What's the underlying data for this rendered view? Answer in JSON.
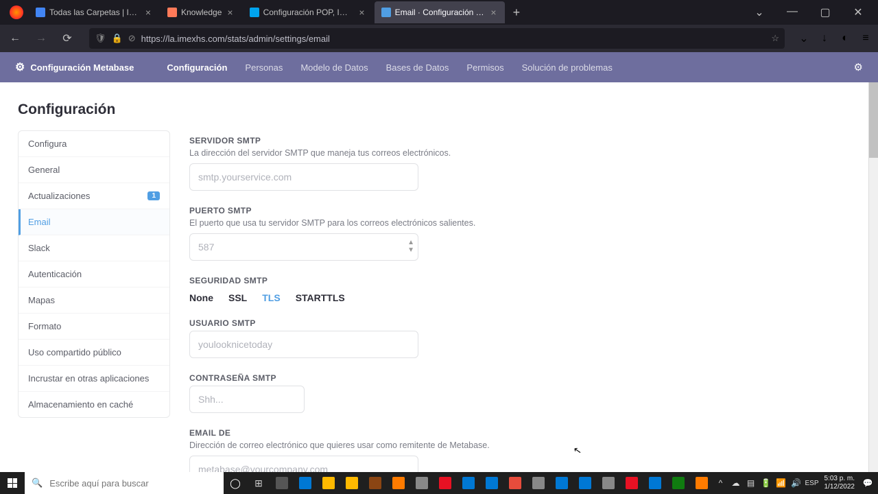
{
  "browser": {
    "tabs": [
      {
        "title": "Todas las Carpetas | Imexl IS (L",
        "favicon": "#4285f4"
      },
      {
        "title": "Knowledge",
        "favicon": "#ff7a59"
      },
      {
        "title": "Configuración POP, IMAP y SM",
        "favicon": "#00a4ef"
      },
      {
        "title": "Email · Configuración · Admin ·",
        "favicon": "#509ee3",
        "active": true
      }
    ],
    "url": "https://la.imexhs.com/stats/admin/settings/email",
    "window_controls": {
      "min": "—",
      "max": "▢",
      "close": "✕"
    }
  },
  "app_nav": {
    "brand": "Configuración Metabase",
    "items": [
      "Configuración",
      "Personas",
      "Modelo de Datos",
      "Bases de Datos",
      "Permisos",
      "Solución de problemas"
    ],
    "active_idx": 0
  },
  "page_title": "Configuración",
  "sidebar": {
    "items": [
      {
        "label": "Configura"
      },
      {
        "label": "General"
      },
      {
        "label": "Actualizaciones",
        "badge": "1"
      },
      {
        "label": "Email",
        "selected": true
      },
      {
        "label": "Slack"
      },
      {
        "label": "Autenticación"
      },
      {
        "label": "Mapas"
      },
      {
        "label": "Formato"
      },
      {
        "label": "Uso compartido público"
      },
      {
        "label": "Incrustar en otras aplicaciones"
      },
      {
        "label": "Almacenamiento en caché"
      }
    ]
  },
  "form": {
    "smtp_host": {
      "label": "SERVIDOR SMTP",
      "desc": "La dirección del servidor SMTP que maneja tus correos electrónicos.",
      "placeholder": "smtp.yourservice.com",
      "value": ""
    },
    "smtp_port": {
      "label": "PUERTO SMTP",
      "desc": "El puerto que usa tu servidor SMTP para los correos electrónicos salientes.",
      "placeholder": "587",
      "value": ""
    },
    "smtp_sec": {
      "label": "SEGURIDAD SMTP",
      "options": [
        "None",
        "SSL",
        "TLS",
        "STARTTLS"
      ],
      "selected": "TLS"
    },
    "smtp_user": {
      "label": "USUARIO SMTP",
      "placeholder": "youlooknicetoday",
      "value": ""
    },
    "smtp_pass": {
      "label": "CONTRASEÑA SMTP",
      "placeholder": "Shh...",
      "value": ""
    },
    "email_from": {
      "label": "EMAIL DE",
      "desc": "Dirección de correo electrónico que quieres usar como remitente de Metabase.",
      "placeholder": "metabase@yourcompany.com",
      "value": ""
    }
  },
  "taskbar": {
    "search_placeholder": "Escribe aquí para buscar",
    "time": "5:03 p. m.",
    "date": "1/12/2022",
    "lang": "ESP",
    "app_colors": [
      "#555",
      "#0078d4",
      "#ffb900",
      "#ffb900",
      "#8b4513",
      "#ff7b00",
      "#888",
      "#e81123",
      "#0078d4",
      "#0078d4",
      "#e74c3c",
      "#888",
      "#0078d4",
      "#0078d4",
      "#888",
      "#e81123",
      "#0078d4",
      "#107c10",
      "#ff7b00"
    ]
  }
}
